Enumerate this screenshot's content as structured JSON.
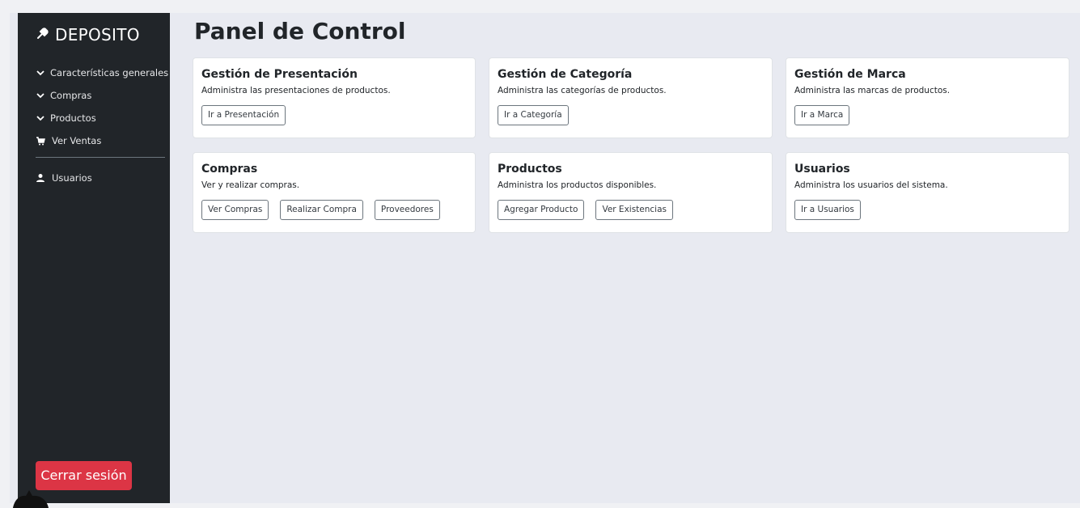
{
  "sidebar": {
    "brand": "DEPOSITO",
    "brand_icon": "pin-icon",
    "items": [
      {
        "label": "Características generales",
        "icon": "chevron-down-icon"
      },
      {
        "label": "Compras",
        "icon": "chevron-down-icon"
      },
      {
        "label": "Productos",
        "icon": "chevron-down-icon"
      },
      {
        "label": "Ver Ventas",
        "icon": "cart-icon"
      }
    ],
    "items2": [
      {
        "label": "Usuarios",
        "icon": "user-icon"
      }
    ],
    "logout_label": "Cerrar sesión"
  },
  "main": {
    "title": "Panel de Control",
    "cards": [
      {
        "title": "Gestión de Presentación",
        "desc": "Administra las presentaciones de productos.",
        "buttons": [
          "Ir a Presentación"
        ]
      },
      {
        "title": "Gestión de Categoría",
        "desc": "Administra las categorías de productos.",
        "buttons": [
          "Ir a Categoría"
        ]
      },
      {
        "title": "Gestión de Marca",
        "desc": "Administra las marcas de productos.",
        "buttons": [
          "Ir a Marca"
        ]
      },
      {
        "title": "Compras",
        "desc": "Ver y realizar compras.",
        "buttons": [
          "Ver Compras",
          "Realizar Compra",
          "Proveedores"
        ]
      },
      {
        "title": "Productos",
        "desc": "Administra los productos disponibles.",
        "buttons": [
          "Agregar Producto",
          "Ver Existencias"
        ]
      },
      {
        "title": "Usuarios",
        "desc": "Administra los usuarios del sistema.",
        "buttons": [
          "Ir a Usuarios"
        ]
      }
    ]
  },
  "colors": {
    "sidebar_bg": "#212529",
    "page_bg": "#e8eaf1",
    "logout_bg": "#dc3545"
  }
}
